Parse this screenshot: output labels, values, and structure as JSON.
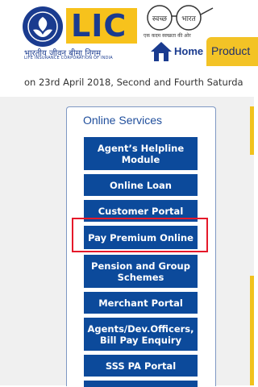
{
  "header": {
    "logo_text": "LIC",
    "logo_hindi": "भारतीय जीवन बीमा निगम",
    "logo_english": "LIFE INSURANCE CORPORATION OF INDIA",
    "swachh_top_left": "स्वच्छ",
    "swachh_top_right": "भारत",
    "swachh_tagline": "एक कदम स्वच्छता की ओर"
  },
  "nav": {
    "home_label": "Home",
    "products_label": "Product"
  },
  "ticker": {
    "text": "on 23rd April 2018, Second and Fourth Saturda"
  },
  "services": {
    "title": "Online Services",
    "items": [
      {
        "label": "Agent’s Helpline Module"
      },
      {
        "label": "Online Loan"
      },
      {
        "label": "Customer Portal"
      },
      {
        "label": "Pay Premium Online"
      },
      {
        "label": "Pension and Group Schemes"
      },
      {
        "label": "Merchant Portal"
      },
      {
        "label": "Agents/Dev.Officers, Bill Pay Enquiry"
      },
      {
        "label": "SSS PA Portal"
      }
    ]
  },
  "colors": {
    "brand_blue": "#0c4a9b",
    "brand_yellow": "#f3c326",
    "highlight_red": "#e5192a"
  }
}
